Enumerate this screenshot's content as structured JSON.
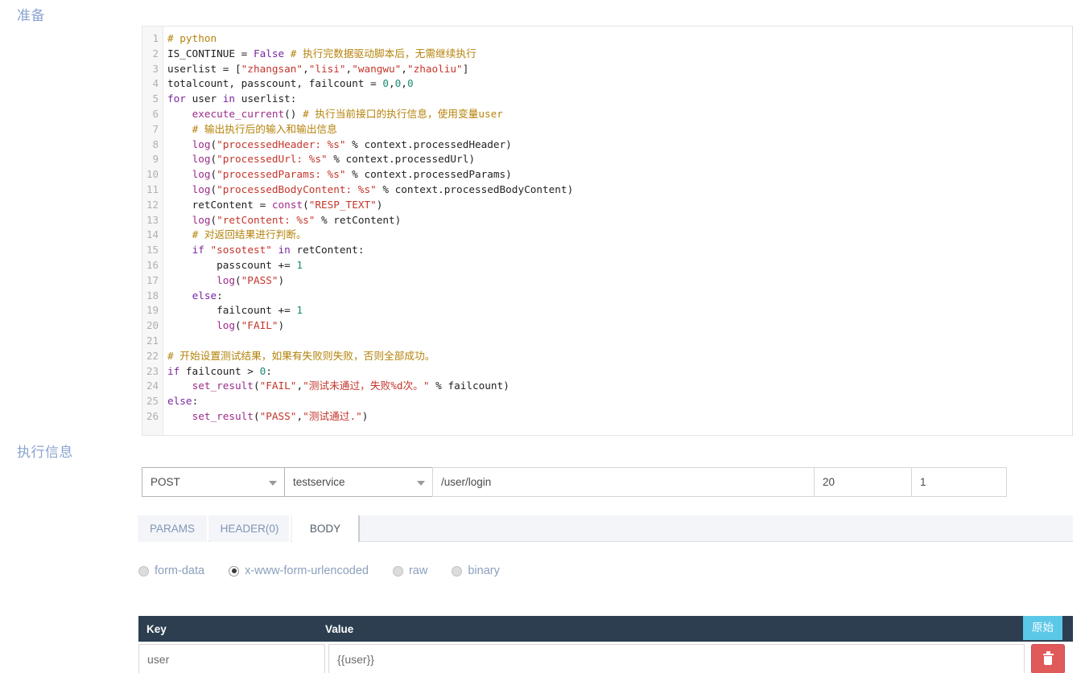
{
  "labels": {
    "prepare": "准备",
    "exec_info": "执行信息"
  },
  "editor": {
    "line_numbers": [
      "1",
      "2",
      "3",
      "4",
      "5",
      "6",
      "7",
      "8",
      "9",
      "10",
      "11",
      "12",
      "13",
      "14",
      "15",
      "16",
      "17",
      "18",
      "19",
      "20",
      "21",
      "22",
      "23",
      "24",
      "25",
      "26"
    ],
    "lines": [
      "# python",
      "IS_CONTINUE = False # 执行完数据驱动脚本后，无需继续执行",
      "userlist = [\"zhangsan\",\"lisi\",\"wangwu\",\"zhaoliu\"]",
      "totalcount, passcount, failcount = 0,0,0",
      "for user in userlist:",
      "    execute_current() # 执行当前接口的执行信息，使用变量user",
      "    # 输出执行后的输入和输出信息",
      "    log(\"processedHeader: %s\" % context.processedHeader)",
      "    log(\"processedUrl: %s\" % context.processedUrl)",
      "    log(\"processedParams: %s\" % context.processedParams)",
      "    log(\"processedBodyContent: %s\" % context.processedBodyContent)",
      "    retContent = const(\"RESP_TEXT\")",
      "    log(\"retContent: %s\" % retContent)",
      "    # 对返回结果进行判断。",
      "    if \"sosotest\" in retContent:",
      "        passcount += 1",
      "        log(\"PASS\")",
      "    else:",
      "        failcount += 1",
      "        log(\"FAIL\")",
      "",
      "# 开始设置测试结果，如果有失败则失败，否则全部成功。",
      "if failcount > 0:",
      "    set_result(\"FAIL\",\"测试未通过，失败%d次。\" % failcount)",
      "else:",
      "    set_result(\"PASS\",\"测试通过.\")"
    ]
  },
  "request": {
    "method": "POST",
    "service": "testservice",
    "path": "/user/login",
    "timeout": "20",
    "repeat": "1"
  },
  "tabs": [
    {
      "id": "params",
      "label": "PARAMS",
      "active": false
    },
    {
      "id": "header",
      "label": "HEADER(0)",
      "active": false
    },
    {
      "id": "body",
      "label": "BODY",
      "active": true
    }
  ],
  "body_types": [
    {
      "label": "form-data",
      "checked": false
    },
    {
      "label": "x-www-form-urlencoded",
      "checked": true
    },
    {
      "label": "raw",
      "checked": false
    },
    {
      "label": "binary",
      "checked": false
    }
  ],
  "kv_table": {
    "col_key": "Key",
    "col_value": "Value",
    "raw_button": "原始",
    "rows": [
      {
        "key": "user",
        "value": "{{user}}"
      }
    ]
  },
  "colors": {
    "header_bg": "#2c3e50",
    "raw_btn": "#5bc8e8",
    "delete_btn": "#e15a5a",
    "label_blue": "#8ba4d0"
  }
}
